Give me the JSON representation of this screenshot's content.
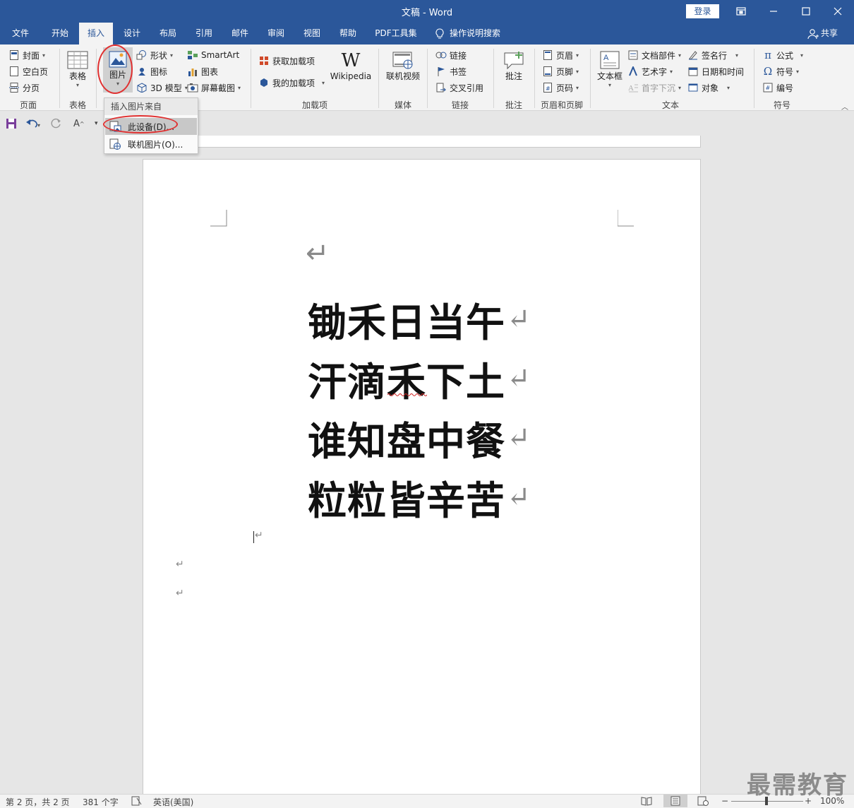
{
  "window": {
    "title": "文稿  -  Word",
    "login_label": "登录"
  },
  "tabs": [
    {
      "label": "文件"
    },
    {
      "label": "开始"
    },
    {
      "label": "插入"
    },
    {
      "label": "设计"
    },
    {
      "label": "布局"
    },
    {
      "label": "引用"
    },
    {
      "label": "邮件"
    },
    {
      "label": "审阅"
    },
    {
      "label": "视图"
    },
    {
      "label": "帮助"
    },
    {
      "label": "PDF工具集"
    }
  ],
  "tell_me": "操作说明搜索",
  "share": "共享",
  "ribbon": {
    "pages": {
      "cover": "封面",
      "blank": "空白页",
      "break": "分页",
      "label": "页面"
    },
    "tables": {
      "table": "表格",
      "label": "表格"
    },
    "illustrations": {
      "picture": "图片",
      "shapes": "形状",
      "icons": "图标",
      "model3d": "3D 模型",
      "smartart": "SmartArt",
      "chart": "图表",
      "screenshot": "屏幕截图"
    },
    "addins": {
      "get": "获取加载项",
      "mine": "我的加载项",
      "wikipedia": "Wikipedia",
      "label": "加载项"
    },
    "media": {
      "video": "联机视频",
      "label": "媒体"
    },
    "links": {
      "link": "链接",
      "bookmark": "书签",
      "crossref": "交叉引用",
      "label": "链接"
    },
    "comments": {
      "comment": "批注",
      "label": "批注"
    },
    "header_footer": {
      "header": "页眉",
      "footer": "页脚",
      "page_number": "页码",
      "label": "页眉和页脚"
    },
    "text": {
      "textbox": "文本框",
      "quickparts": "文档部件",
      "wordart": "艺术字",
      "dropcap": "首字下沉",
      "signature": "签名行",
      "datetime": "日期和时间",
      "object": "对象",
      "label": "文本"
    },
    "symbols": {
      "equation": "公式",
      "symbol": "符号",
      "number": "编号",
      "label": "符号"
    }
  },
  "picture_menu": {
    "header": "插入图片来自",
    "items": [
      {
        "label": "此设备(D)..."
      },
      {
        "label": "联机图片(O)..."
      }
    ]
  },
  "document": {
    "lines": [
      {
        "text": "锄禾日当午"
      },
      {
        "text": "汗滴禾下土"
      },
      {
        "text": "谁知盘中餐"
      },
      {
        "text": "粒粒皆辛苦"
      }
    ],
    "paragraph_mark": "↵"
  },
  "status": {
    "page": "第 2 页，共 2 页",
    "words": "381 个字",
    "language": "英语(美国)",
    "zoom": "100%"
  },
  "watermark": "最需教育",
  "colors": {
    "brand": "#2b579a",
    "ribbon_bg": "#f3f3f3",
    "highlight_circle": "#e03030"
  }
}
